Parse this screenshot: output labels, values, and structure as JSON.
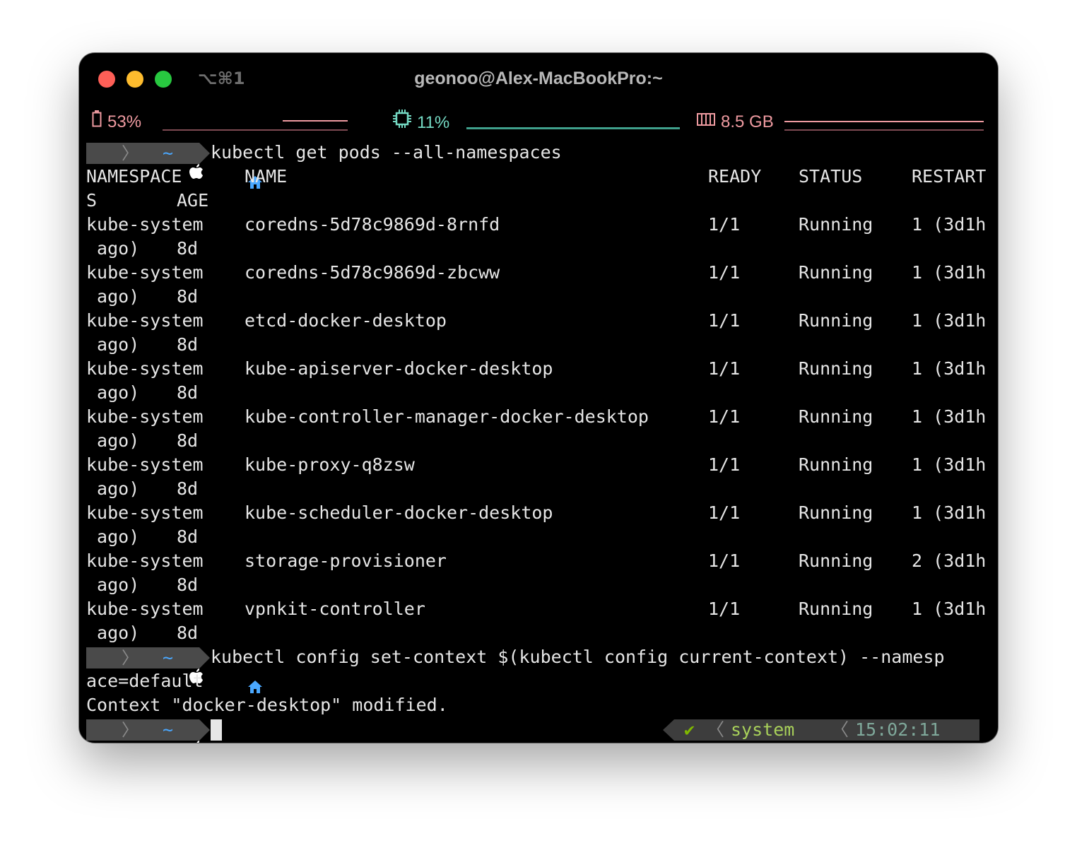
{
  "window": {
    "title": "geonoo@Alex-MacBookPro:~",
    "shortcut": "⌥⌘1"
  },
  "status": {
    "battery": "53%",
    "cpu": "11%",
    "memory": "8.5 GB"
  },
  "prompt": {
    "apple_glyph": "",
    "separator": "〉",
    "dir": "~"
  },
  "commands": {
    "cmd1": "kubectl get pods --all-namespaces",
    "cmd2_line1": "kubectl config set-context $(kubectl config current-context) --namesp",
    "cmd2_line2": "ace=default",
    "cmd2_output": "Context \"docker-desktop\" modified."
  },
  "table": {
    "headers": {
      "namespace": "NAMESPACE",
      "name": "NAME",
      "ready": "READY",
      "status": "STATUS",
      "restart": "RESTART",
      "restart_wrap": "S",
      "age": "AGE"
    },
    "rows": [
      {
        "namespace": "kube-system",
        "name": "coredns-5d78c9869d-8rnfd",
        "ready": "1/1",
        "status": "Running",
        "restarts": "1 (3d1h",
        "restarts_wrap": " ago)",
        "age": "8d"
      },
      {
        "namespace": "kube-system",
        "name": "coredns-5d78c9869d-zbcww",
        "ready": "1/1",
        "status": "Running",
        "restarts": "1 (3d1h",
        "restarts_wrap": " ago)",
        "age": "8d"
      },
      {
        "namespace": "kube-system",
        "name": "etcd-docker-desktop",
        "ready": "1/1",
        "status": "Running",
        "restarts": "1 (3d1h",
        "restarts_wrap": " ago)",
        "age": "8d"
      },
      {
        "namespace": "kube-system",
        "name": "kube-apiserver-docker-desktop",
        "ready": "1/1",
        "status": "Running",
        "restarts": "1 (3d1h",
        "restarts_wrap": " ago)",
        "age": "8d"
      },
      {
        "namespace": "kube-system",
        "name": "kube-controller-manager-docker-desktop",
        "ready": "1/1",
        "status": "Running",
        "restarts": "1 (3d1h",
        "restarts_wrap": " ago)",
        "age": "8d"
      },
      {
        "namespace": "kube-system",
        "name": "kube-proxy-q8zsw",
        "ready": "1/1",
        "status": "Running",
        "restarts": "1 (3d1h",
        "restarts_wrap": " ago)",
        "age": "8d"
      },
      {
        "namespace": "kube-system",
        "name": "kube-scheduler-docker-desktop",
        "ready": "1/1",
        "status": "Running",
        "restarts": "1 (3d1h",
        "restarts_wrap": " ago)",
        "age": "8d"
      },
      {
        "namespace": "kube-system",
        "name": "storage-provisioner",
        "ready": "1/1",
        "status": "Running",
        "restarts": "2 (3d1h",
        "restarts_wrap": " ago)",
        "age": "8d"
      },
      {
        "namespace": "kube-system",
        "name": "vpnkit-controller",
        "ready": "1/1",
        "status": "Running",
        "restarts": "1 (3d1h",
        "restarts_wrap": " ago)",
        "age": "8d"
      }
    ]
  },
  "right_prompt": {
    "check": "✔",
    "separator": "〈",
    "user": "system",
    "time": "15:02:11"
  },
  "colors": {
    "close": "#fe5f57",
    "minimize": "#febc2e",
    "maximize": "#28c840",
    "battery": "#ee9aa0",
    "cpu": "#74d9c3",
    "dir": "#4aa8ff",
    "user": "#a8d05a"
  }
}
